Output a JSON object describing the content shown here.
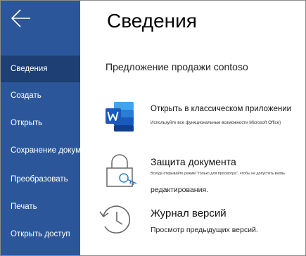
{
  "colors": {
    "sidebar_bg": "#2b579a",
    "sidebar_active": "#1e3f73",
    "word_blue": "#185abd"
  },
  "sidebar": {
    "back_icon": "arrow-left-icon",
    "items": [
      {
        "label": "Сведения",
        "active": true
      },
      {
        "label": "Создать",
        "active": false
      },
      {
        "label": "Открыть",
        "active": false
      },
      {
        "label": "Сохранение документа",
        "active": false
      },
      {
        "label": "Преобразовать",
        "active": false
      },
      {
        "label": "Печать",
        "active": false
      },
      {
        "label": "Открыть доступ",
        "active": false
      }
    ]
  },
  "main": {
    "title": "Сведения",
    "document_name": "Предложение продажи contoso",
    "actions": [
      {
        "icon": "word-app-icon",
        "title": "Открыть в классическом приложении",
        "description": "Используйте все функциональные возможности Microsoft Office)"
      },
      {
        "icon": "lock-key-icon",
        "title": "Защита документа",
        "description": "Всегда открывайте режим \"только для просмотра\", чтобы не допустить вновь",
        "description2": "редактирования."
      },
      {
        "icon": "history-icon",
        "title": "Журнал версий",
        "description": "Просмотр предыдущих версий."
      }
    ]
  }
}
